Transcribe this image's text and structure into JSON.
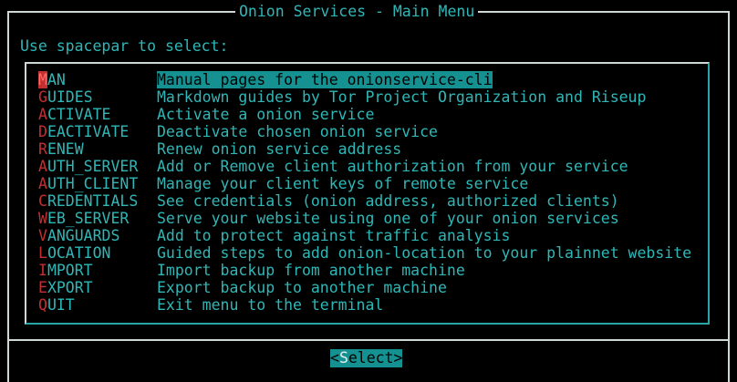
{
  "dialog": {
    "title": "Onion Services - Main Menu",
    "prompt": "Use spacepar to select:"
  },
  "menu": {
    "selected_index": 0,
    "items": [
      {
        "tag_hot": "M",
        "tag_rest": "AN",
        "description": "Manual pages for the onionservice-cli"
      },
      {
        "tag_hot": "G",
        "tag_rest": "UIDES",
        "description": "Markdown guides by Tor Project Organization and Riseup"
      },
      {
        "tag_hot": "A",
        "tag_rest": "CTIVATE",
        "description": "Activate a onion service"
      },
      {
        "tag_hot": "D",
        "tag_rest": "EACTIVATE",
        "description": "Deactivate chosen onion service"
      },
      {
        "tag_hot": "R",
        "tag_rest": "ENEW",
        "description": "Renew onion service address"
      },
      {
        "tag_hot": "A",
        "tag_rest": "UTH_SERVER",
        "description": "Add or Remove client authorization from your service"
      },
      {
        "tag_hot": "A",
        "tag_rest": "UTH_CLIENT",
        "description": "Manage your client keys of remote service"
      },
      {
        "tag_hot": "C",
        "tag_rest": "REDENTIALS",
        "description": "See credentials (onion address, authorized clients)"
      },
      {
        "tag_hot": "W",
        "tag_rest": "EB_SERVER",
        "description": "Serve your website using one of your onion services"
      },
      {
        "tag_hot": "V",
        "tag_rest": "ANGUARDS",
        "description": "Add to protect against traffic analysis"
      },
      {
        "tag_hot": "L",
        "tag_rest": "OCATION",
        "description": "Guided steps to add onion-location to your plainnet website"
      },
      {
        "tag_hot": "I",
        "tag_rest": "MPORT",
        "description": "Import backup from another machine"
      },
      {
        "tag_hot": "E",
        "tag_rest": "XPORT",
        "description": "Export backup to another machine"
      },
      {
        "tag_hot": "Q",
        "tag_rest": "UIT",
        "description": "Exit menu to the terminal"
      }
    ]
  },
  "buttons": {
    "select_open": "<",
    "select_hot": "S",
    "select_rest": "elect",
    "select_close": ">"
  },
  "colors": {
    "background": "#000000",
    "text": "#2fb7b7",
    "hotkey": "#c33030",
    "highlight": "#159191",
    "border": "#cfd6d6"
  }
}
